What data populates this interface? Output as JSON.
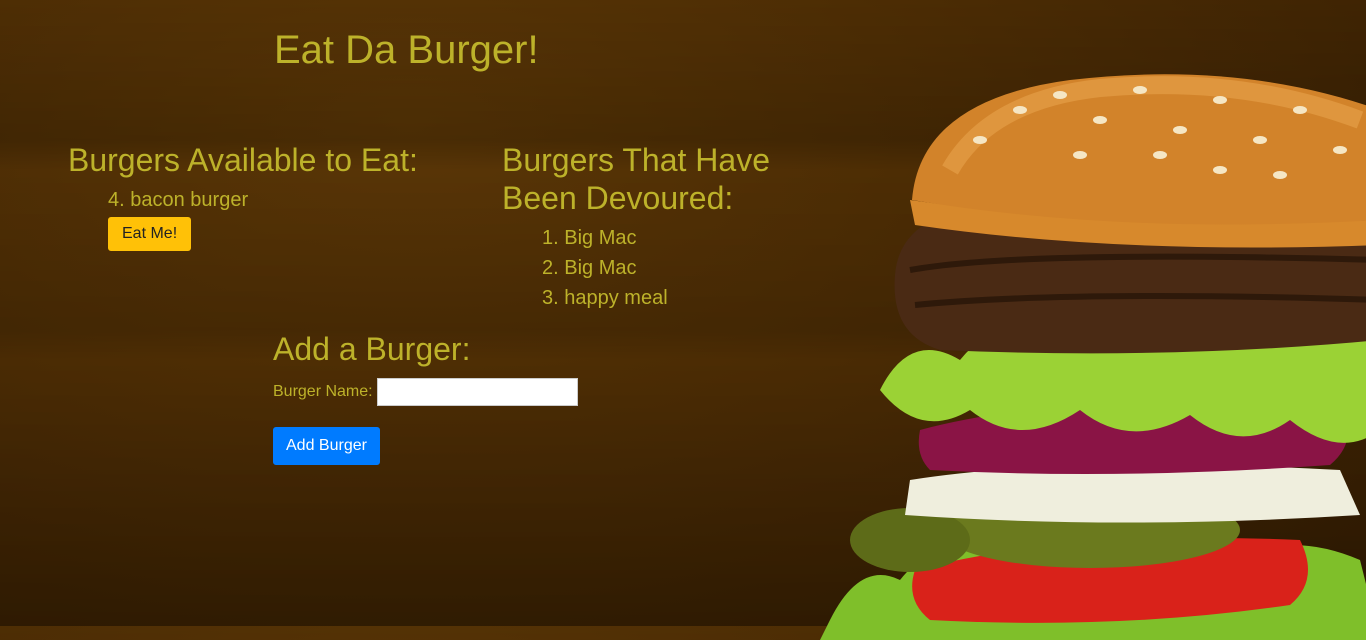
{
  "header": {
    "title": "Eat Da Burger!"
  },
  "available": {
    "title": "Burgers Available to Eat:",
    "items": [
      {
        "label": "4. bacon burger",
        "button_label": "Eat Me!"
      }
    ]
  },
  "devoured": {
    "title": "Burgers That Have Been Devoured:",
    "items": [
      {
        "label": "1. Big Mac"
      },
      {
        "label": "2. Big Mac"
      },
      {
        "label": "3. happy meal"
      }
    ]
  },
  "add_form": {
    "title": "Add a Burger:",
    "field_label": "Burger Name:",
    "field_value": "",
    "submit_label": "Add Burger"
  },
  "colors": {
    "text_gold": "#bdb22a",
    "eat_button": "#ffc107",
    "add_button": "#007bff",
    "background": "#4a2b04"
  }
}
